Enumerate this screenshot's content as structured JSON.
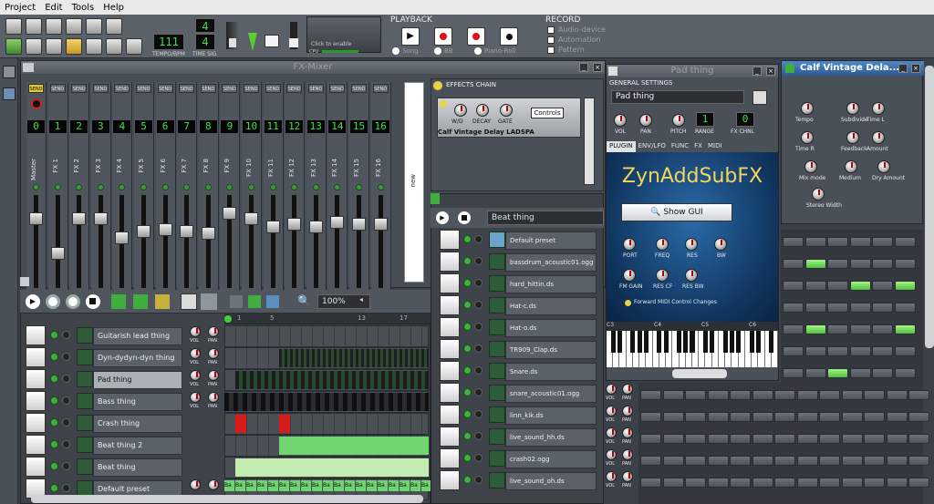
{
  "menu": [
    "Project",
    "Edit",
    "Tools",
    "Help"
  ],
  "toolbar": {
    "tempo": "111",
    "tempo_label": "TEMPO/BPM",
    "timesig_top": "4",
    "timesig_bottom": "4",
    "timesig_label": "TIME SIG",
    "cpu_label": "CPU",
    "click_to_enable": "Click to enable",
    "playback_label": "PLAYBACK",
    "record_label": "RECORD",
    "record_options": [
      "Audio-device",
      "Automation",
      "Pattern"
    ],
    "playback_sources": [
      "Song",
      "BB",
      "Piano-Roll"
    ]
  },
  "fx_mixer": {
    "title": "FX-Mixer",
    "send_label": "SEND",
    "new_label": "new",
    "channels": [
      {
        "num": "0",
        "name": "Master"
      },
      {
        "num": "1",
        "name": "FX 1"
      },
      {
        "num": "2",
        "name": "FX 2"
      },
      {
        "num": "3",
        "name": "FX 3"
      },
      {
        "num": "4",
        "name": "FX 4"
      },
      {
        "num": "5",
        "name": "FX 5"
      },
      {
        "num": "6",
        "name": "FX 6"
      },
      {
        "num": "7",
        "name": "FX 7"
      },
      {
        "num": "8",
        "name": "FX 8"
      },
      {
        "num": "9",
        "name": "FX 9"
      },
      {
        "num": "10",
        "name": "FX 10"
      },
      {
        "num": "11",
        "name": "FX 11"
      },
      {
        "num": "12",
        "name": "FX 12"
      },
      {
        "num": "13",
        "name": "FX 13"
      },
      {
        "num": "14",
        "name": "FX 14"
      },
      {
        "num": "15",
        "name": "FX 15"
      },
      {
        "num": "16",
        "name": "FX 16"
      }
    ],
    "fader_levels": [
      0.78,
      0.35,
      0.78,
      0.78,
      0.55,
      0.62,
      0.65,
      0.62,
      0.6,
      0.85,
      0.78,
      0.68,
      0.72,
      0.68,
      0.74,
      0.72,
      0.72
    ]
  },
  "effects_chain": {
    "title": "EFFECTS CHAIN",
    "knobs": [
      "W/D",
      "DECAY",
      "GATE"
    ],
    "controls_button": "Controls",
    "plugin_name": "Calf Vintage Delay LADSPA"
  },
  "song_editor": {
    "zoom": "100%",
    "ruler": [
      "1",
      "5",
      "13",
      "17"
    ],
    "tracks": [
      {
        "name": "Guitarish lead thing",
        "selected": false
      },
      {
        "name": "Dyn-dydyn-dyn thing",
        "selected": false
      },
      {
        "name": "Pad thing",
        "selected": true
      },
      {
        "name": "Bass thing",
        "selected": false
      },
      {
        "name": "Crash thing",
        "selected": false
      },
      {
        "name": "Beat thing 2",
        "selected": false
      },
      {
        "name": "Beat thing",
        "selected": false
      },
      {
        "name": "Default preset",
        "selected": false
      }
    ],
    "vol_label": "VOL",
    "pan_label": "PAN",
    "pattern_label": "Ba"
  },
  "beat_editor": {
    "preset": "Beat thing",
    "instruments": [
      "Default preset",
      "bassdrum_acoustic01.ogg",
      "hard_hittin.ds",
      "Hat-c.ds",
      "Hat-o.ds",
      "TR909_Clap.ds",
      "Snare.ds",
      "snare_acoustic01.ogg",
      "linn_kik.ds",
      "live_sound_hh.ds",
      "crash02.ogg",
      "live_sound_oh.ds"
    ]
  },
  "instrument": {
    "title": "Pad thing",
    "general_settings": "GENERAL SETTINGS",
    "name": "Pad thing",
    "knobs": [
      "VOL",
      "PAN",
      "PITCH"
    ],
    "range_label": "RANGE",
    "range_value": "1",
    "fx_chnl_label": "FX CHNL",
    "fx_chnl_value": "0",
    "tabs": [
      "PLUGIN",
      "ENV/LFO",
      "FUNC",
      "FX",
      "MIDI"
    ],
    "plugin_title": "ZynAddSubFX",
    "show_gui": "Show GUI",
    "plugin_knobs": [
      "PORT",
      "FREQ",
      "RES",
      "BW",
      "FM GAIN",
      "RES CF",
      "RES BW"
    ],
    "forward_midi": "Forward MIDI Control Changes",
    "octaves": [
      "C3",
      "C4",
      "C5",
      "C6"
    ]
  },
  "calf": {
    "title": "Calf Vintage Dela...",
    "knobs": [
      "Tempo",
      "Subdivide",
      "Time L",
      "Time R",
      "Feedback",
      "Amount",
      "Mix mode",
      "Medium",
      "Dry Amount",
      "Stereo Width"
    ]
  }
}
